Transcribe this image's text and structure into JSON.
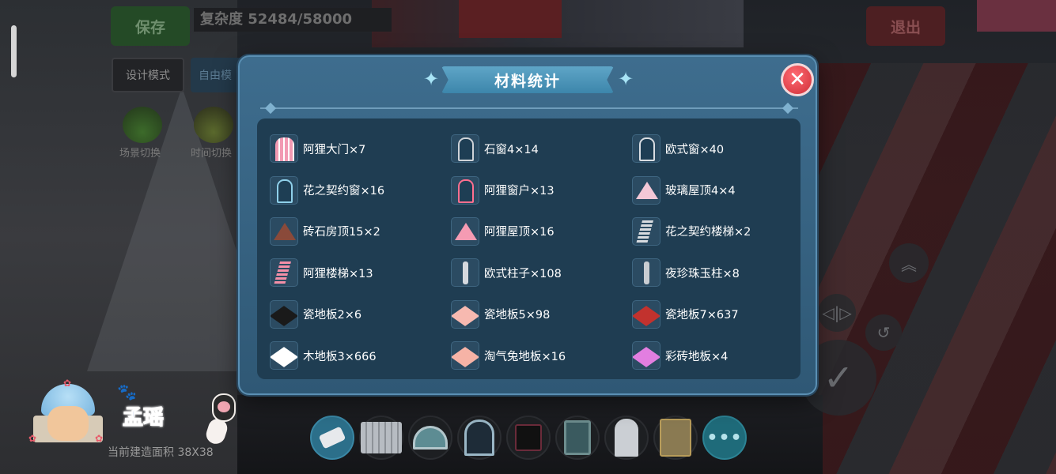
{
  "hud": {
    "save_label": "保存",
    "complexity": "复杂度 52484/58000",
    "exit_label": "退出",
    "mode_design": "设计模式",
    "mode_free": "自由模",
    "scene_switch": "场景切换",
    "time_switch": "时间切换"
  },
  "player": {
    "name": "孟瑶",
    "build_area": "当前建造面积 38X38"
  },
  "dialog": {
    "title": "材料统计",
    "items": [
      {
        "name": "阿狸大门×7",
        "icon": "pink-gate-icon",
        "color": "#f29ab3"
      },
      {
        "name": "石窗4×14",
        "icon": "stone-window-icon",
        "color": "#cfd3d8"
      },
      {
        "name": "欧式窗×40",
        "icon": "european-window-icon",
        "color": "#d9dde2"
      },
      {
        "name": "花之契约窗×16",
        "icon": "flower-window-icon",
        "color": "#8fd0ea"
      },
      {
        "name": "阿狸窗户×13",
        "icon": "ahri-window-icon",
        "color": "#ff6f8f"
      },
      {
        "name": "玻璃屋顶4×4",
        "icon": "glass-roof-icon",
        "color": "#f3c7d6"
      },
      {
        "name": "砖石房顶15×2",
        "icon": "brick-roof-icon",
        "color": "#8a4a3a"
      },
      {
        "name": "阿狸屋顶×16",
        "icon": "ahri-roof-icon",
        "color": "#f59bb3"
      },
      {
        "name": "花之契约楼梯×2",
        "icon": "flower-stairs-icon",
        "color": "#d8dce0"
      },
      {
        "name": "阿狸楼梯×13",
        "icon": "ahri-stairs-icon",
        "color": "#f48fa8"
      },
      {
        "name": "欧式柱子×108",
        "icon": "european-pillar-icon",
        "color": "#d6d9de"
      },
      {
        "name": "夜珍珠玉柱×8",
        "icon": "pearl-pillar-icon",
        "color": "#c9cdd2"
      },
      {
        "name": "瓷地板2×6",
        "icon": "black-tile-icon",
        "color": "#1a1a1a"
      },
      {
        "name": "瓷地板5×98",
        "icon": "pink-tile-icon",
        "color": "#f7b9b0"
      },
      {
        "name": "瓷地板7×637",
        "icon": "red-tile-icon",
        "color": "#c2322e"
      },
      {
        "name": "木地板3×666",
        "icon": "white-floor-icon",
        "color": "#ffffff"
      },
      {
        "name": "淘气兔地板×16",
        "icon": "bunny-floor-icon",
        "color": "#f6b3a6"
      },
      {
        "name": "彩砖地板×4",
        "icon": "colored-tile-icon",
        "color": "#e27ee0"
      }
    ]
  },
  "toolbar": {
    "more_label": "•••"
  }
}
